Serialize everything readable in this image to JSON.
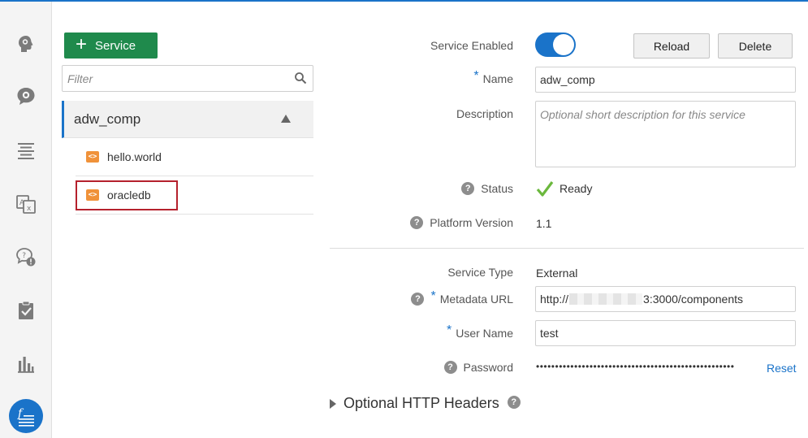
{
  "colors": {
    "accent": "#1a73c9",
    "add_button": "#1f8a4c",
    "ready_check": "#6bb83d",
    "highlight": "#b5212d",
    "service_icon": "#f0923a"
  },
  "rail": {
    "items": [
      {
        "icon": "bot-head-icon"
      },
      {
        "icon": "settings-chat-icon"
      },
      {
        "icon": "text-lines-icon"
      },
      {
        "icon": "translate-icon"
      },
      {
        "icon": "chat-alert-icon"
      },
      {
        "icon": "clipboard-check-icon"
      },
      {
        "icon": "bar-chart-icon"
      },
      {
        "icon": "function-icon",
        "active": true
      }
    ]
  },
  "services_panel": {
    "add_button_label": "Service",
    "filter_placeholder": "Filter",
    "group_name": "adw_comp",
    "items": [
      {
        "name": "hello.world"
      },
      {
        "name": "oracledb"
      }
    ]
  },
  "form": {
    "enabled_label": "Service Enabled",
    "reload_label": "Reload",
    "delete_label": "Delete",
    "required_mark": "*",
    "help_mark": "?",
    "name_label": "Name",
    "name_value": "adw_comp",
    "description_label": "Description",
    "description_placeholder": "Optional short description for this service",
    "status_label": "Status",
    "status_value": "Ready",
    "platform_label": "Platform Version",
    "platform_value": "1.1",
    "type_label": "Service Type",
    "type_value": "External",
    "metadata_label": "Metadata URL",
    "metadata_prefix": "http://",
    "metadata_suffix": "3:3000/components",
    "user_label": "User Name",
    "user_value": "test",
    "password_label": "Password",
    "password_mask": "••••••••••••••••••••••••••••••••••••••••••••••••••••",
    "reset_label": "Reset",
    "headers_label": "Optional HTTP Headers"
  }
}
